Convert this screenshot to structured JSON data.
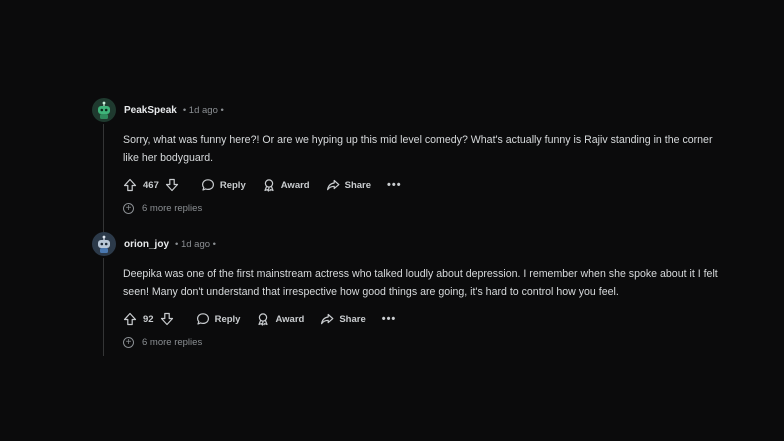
{
  "comments": [
    {
      "username": "PeakSpeak",
      "time": "• 1d ago •",
      "avatar_icon": "robot-avatar-green",
      "text": "Sorry, what was funny here?! Or are we hyping up this mid level comedy? What's actually funny is Rajiv standing in the corner like her bodyguard.",
      "votes": "467",
      "reply_label": "Reply",
      "award_label": "Award",
      "share_label": "Share",
      "more_label": "•••",
      "more_replies": "6 more replies"
    },
    {
      "username": "orion_joy",
      "time": "• 1d ago •",
      "avatar_icon": "robot-avatar-blue",
      "text": "Deepika was one of the first mainstream actress who talked loudly about depression. I remember when she spoke about it I felt seen! Many don't understand that irrespective how good things are going, it's hard to control how you feel.",
      "votes": "92",
      "reply_label": "Reply",
      "award_label": "Award",
      "share_label": "Share",
      "more_label": "•••",
      "more_replies": "6 more replies"
    }
  ]
}
